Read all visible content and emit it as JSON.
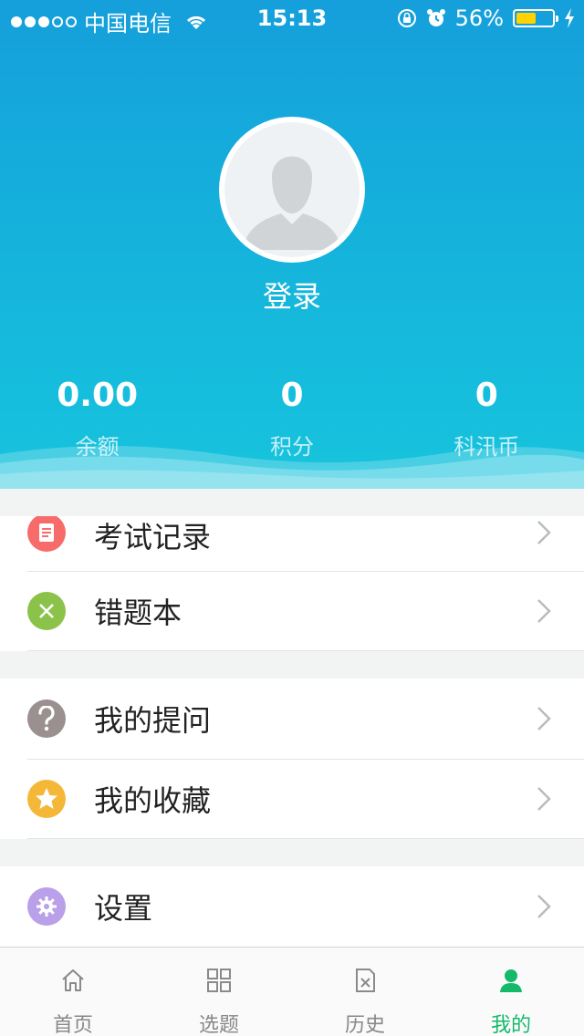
{
  "status_bar": {
    "carrier": "中国电信",
    "time": "15:13",
    "battery_percent": "56%",
    "battery_level": 0.56,
    "battery_color": "#ffd200",
    "signal_strength": 3
  },
  "profile": {
    "login_label": "登录",
    "avatar_icon": "default-avatar-icon"
  },
  "stats": [
    {
      "value": "0.00",
      "label": "余额"
    },
    {
      "value": "0",
      "label": "积分"
    },
    {
      "value": "0",
      "label": "科汛币"
    }
  ],
  "menu": {
    "exam_records": {
      "label": "考试记录",
      "icon": "document-icon",
      "color": "#f86b6b"
    },
    "wrong_questions": {
      "label": "错题本",
      "icon": "close-icon",
      "color": "#8bc34a"
    },
    "my_questions": {
      "label": "我的提问",
      "icon": "question-icon",
      "color": "#9b9090"
    },
    "my_favorites": {
      "label": "我的收藏",
      "icon": "star-icon",
      "color": "#f5b738"
    },
    "settings": {
      "label": "设置",
      "icon": "gear-icon",
      "color": "#b9a0e8"
    }
  },
  "tabbar": [
    {
      "label": "首页",
      "icon": "home-icon",
      "active": false
    },
    {
      "label": "选题",
      "icon": "grid-icon",
      "active": false
    },
    {
      "label": "历史",
      "icon": "history-icon",
      "active": false
    },
    {
      "label": "我的",
      "icon": "user-icon",
      "active": true
    }
  ],
  "colors": {
    "header_top": "#159fdb",
    "header_bottom": "#17c4dd",
    "active_tab": "#14b96a"
  }
}
